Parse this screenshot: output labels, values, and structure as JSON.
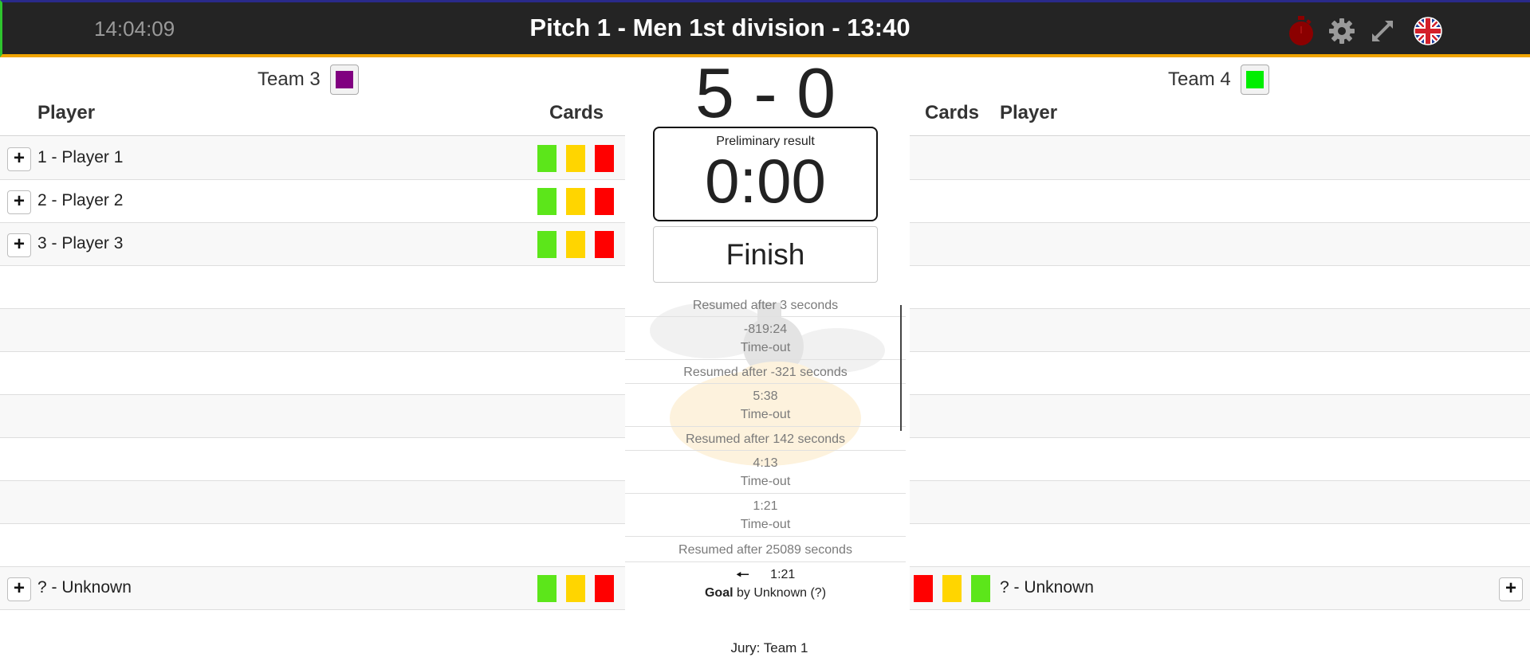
{
  "header": {
    "clock": "14:04:09",
    "title": "Pitch 1 - Men 1st division - 13:40"
  },
  "icons": {
    "timer": "stopwatch-icon",
    "settings": "gear-icon",
    "fullscreen": "expand-icon",
    "language": "uk-flag-icon"
  },
  "colors": {
    "topbar": "#242424",
    "accent_bottom": "#f0a400",
    "timer_icon": "#8b0000",
    "team_left": "#800080",
    "team_right": "#00ee00",
    "card_green": "#5ce61a",
    "card_yellow": "#ffd500",
    "card_red": "#ff0000"
  },
  "team_left": {
    "name": "Team 3"
  },
  "team_right": {
    "name": "Team 4"
  },
  "score": "5 - 0",
  "columns": {
    "player": "Player",
    "cards": "Cards"
  },
  "timer": {
    "label": "Preliminary result",
    "value": "0:00"
  },
  "finish_label": "Finish",
  "left_players": [
    {
      "label": "1 - Player 1"
    },
    {
      "label": "2 - Player 2"
    },
    {
      "label": "3 - Player 3"
    }
  ],
  "unknown_label": "? - Unknown",
  "log": [
    {
      "line1": "Resumed after 3 seconds"
    },
    {
      "line1": "-819:24",
      "line2": "Time-out"
    },
    {
      "line1": "Resumed after -321 seconds"
    },
    {
      "line1": "5:38",
      "line2": "Time-out"
    },
    {
      "line1": "Resumed after 142 seconds"
    },
    {
      "line1": "4:13",
      "line2": "Time-out"
    },
    {
      "line1": "1:21",
      "line2": "Time-out"
    },
    {
      "line1": "Resumed after 25089 seconds"
    }
  ],
  "goal_event": {
    "time": "1:21",
    "bold": "Goal",
    "rest": "by Unknown (?)"
  },
  "jury": "Jury: Team 1"
}
